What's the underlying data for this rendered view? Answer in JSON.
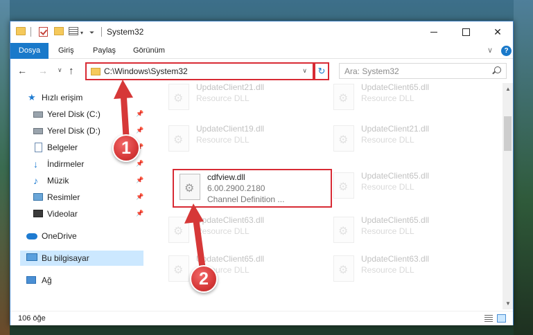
{
  "window": {
    "title": "System32"
  },
  "ribbon": {
    "tabs": [
      "Dosya",
      "Giriş",
      "Paylaş",
      "Görünüm"
    ],
    "help": "?"
  },
  "navigation": {
    "address": "C:\\Windows\\System32",
    "search_placeholder": "Ara: System32"
  },
  "sidebar": {
    "items": [
      {
        "label": "Hızlı erişim",
        "icon": "star-icon"
      },
      {
        "label": "Yerel Disk (C:)",
        "icon": "drive-icon",
        "pinned": true
      },
      {
        "label": "Yerel Disk (D:)",
        "icon": "drive-icon",
        "pinned": true
      },
      {
        "label": "Belgeler",
        "icon": "document-icon",
        "pinned": true
      },
      {
        "label": "İndirmeler",
        "icon": "download-icon",
        "pinned": true
      },
      {
        "label": "Müzik",
        "icon": "music-icon",
        "pinned": true
      },
      {
        "label": "Resimler",
        "icon": "pictures-icon",
        "pinned": true
      },
      {
        "label": "Videolar",
        "icon": "video-icon",
        "pinned": true
      },
      {
        "label": "OneDrive",
        "icon": "cloud-icon"
      },
      {
        "label": "Bu bilgisayar",
        "icon": "computer-icon",
        "selected": true
      },
      {
        "label": "Ağ",
        "icon": "network-icon"
      }
    ]
  },
  "files": [
    {
      "name": "UpdateClient21.dll",
      "desc": "Resource DLL",
      "faded": true
    },
    {
      "name": "UpdateClient65.dll",
      "desc": "Resource DLL",
      "faded": true
    },
    {
      "name": "UpdateClient19.dll",
      "desc": "Resource DLL",
      "faded": true
    },
    {
      "name": "UpdateClient21.dll",
      "desc": "Resource DLL",
      "faded": true
    },
    {
      "name": "cdfview.dll",
      "version": "6.00.2900.2180",
      "desc": "Channel Definition ...",
      "highlighted": true
    },
    {
      "name": "UpdateClient65.dll",
      "desc": "Resource DLL",
      "faded": true
    },
    {
      "name": "UpdateClient63.dll",
      "desc": "Resource DLL",
      "faded": true
    },
    {
      "name": "UpdateClient65.dll",
      "desc": "Resource DLL",
      "faded": true
    },
    {
      "name": "UpdateClient65.dll",
      "desc": "Resource DLL",
      "faded": true
    },
    {
      "name": "UpdateClient63.dll",
      "desc": "Resource DLL",
      "faded": true
    }
  ],
  "status": {
    "item_count": "106 öğe"
  },
  "callouts": [
    "1",
    "2"
  ],
  "colors": {
    "accent": "#1979ca",
    "highlight_border": "#d82a34",
    "selected_bg": "#cce8ff"
  }
}
